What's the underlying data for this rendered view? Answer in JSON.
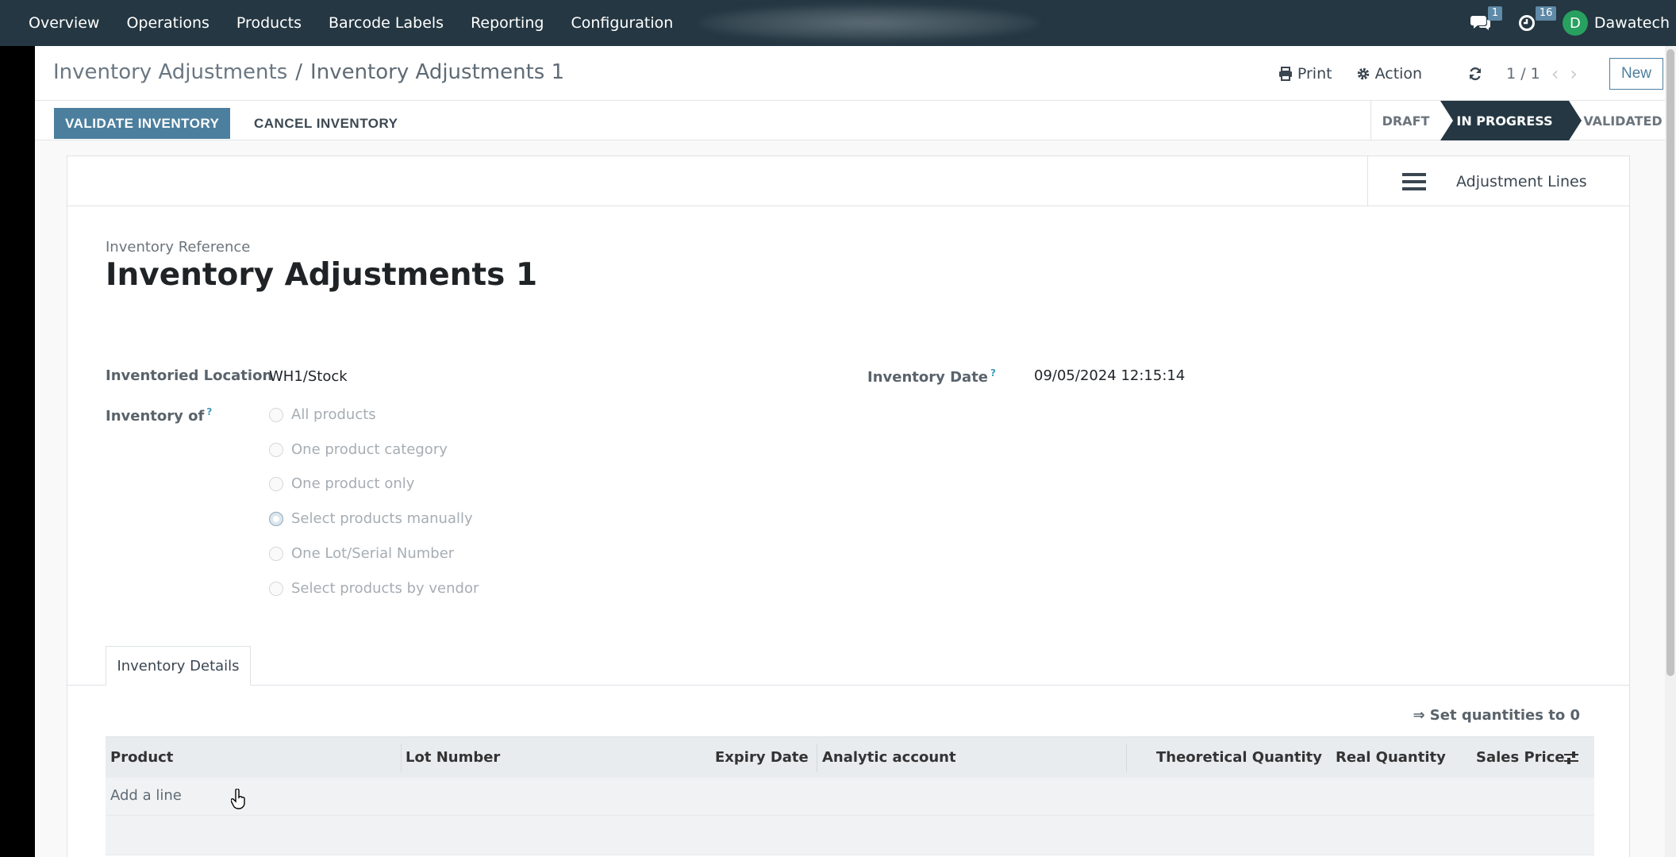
{
  "navbar": {
    "menu": [
      "Overview",
      "Operations",
      "Products",
      "Barcode Labels",
      "Reporting",
      "Configuration"
    ],
    "messages_count": "1",
    "activities_count": "16",
    "avatar_initial": "D",
    "username": "Dawatech"
  },
  "control_panel": {
    "breadcrumb_parent": "Inventory Adjustments",
    "breadcrumb_separator": "/",
    "breadcrumb_current": "Inventory Adjustments 1",
    "print_label": "Print",
    "action_label": "Action",
    "pager": "1 / 1",
    "new_label": "New"
  },
  "statusbar": {
    "validate_label": "VALIDATE INVENTORY",
    "cancel_label": "CANCEL INVENTORY",
    "stages": [
      "DRAFT",
      "IN PROGRESS",
      "VALIDATED"
    ],
    "active_stage": "IN PROGRESS"
  },
  "sheet": {
    "smart_button_label": "Adjustment Lines",
    "reference_label": "Inventory Reference",
    "reference_value": "Inventory Adjustments 1",
    "location_label": "Inventoried Location",
    "location_value": "WH1/Stock",
    "date_label": "Inventory Date",
    "date_value": "09/05/2024 12:15:14",
    "inventory_of_label": "Inventory of",
    "help_mark": "?",
    "inventory_of_options": [
      "All products",
      "One product category",
      "One product only",
      "Select products manually",
      "One Lot/Serial Number",
      "Select products by vendor"
    ],
    "selected_option": "Select products manually",
    "tab_label": "Inventory Details",
    "set_quantities_label": "⇒ Set quantities to 0",
    "table_headers": [
      "Product",
      "Lot Number",
      "Expiry Date",
      "Analytic account",
      "Theoretical Quantity",
      "Real Quantity",
      "Sales Price"
    ],
    "add_line_label": "Add a line"
  },
  "colors": {
    "navbar": "#243742",
    "primary": "#4c7f9e",
    "active_stage": "#243742"
  }
}
